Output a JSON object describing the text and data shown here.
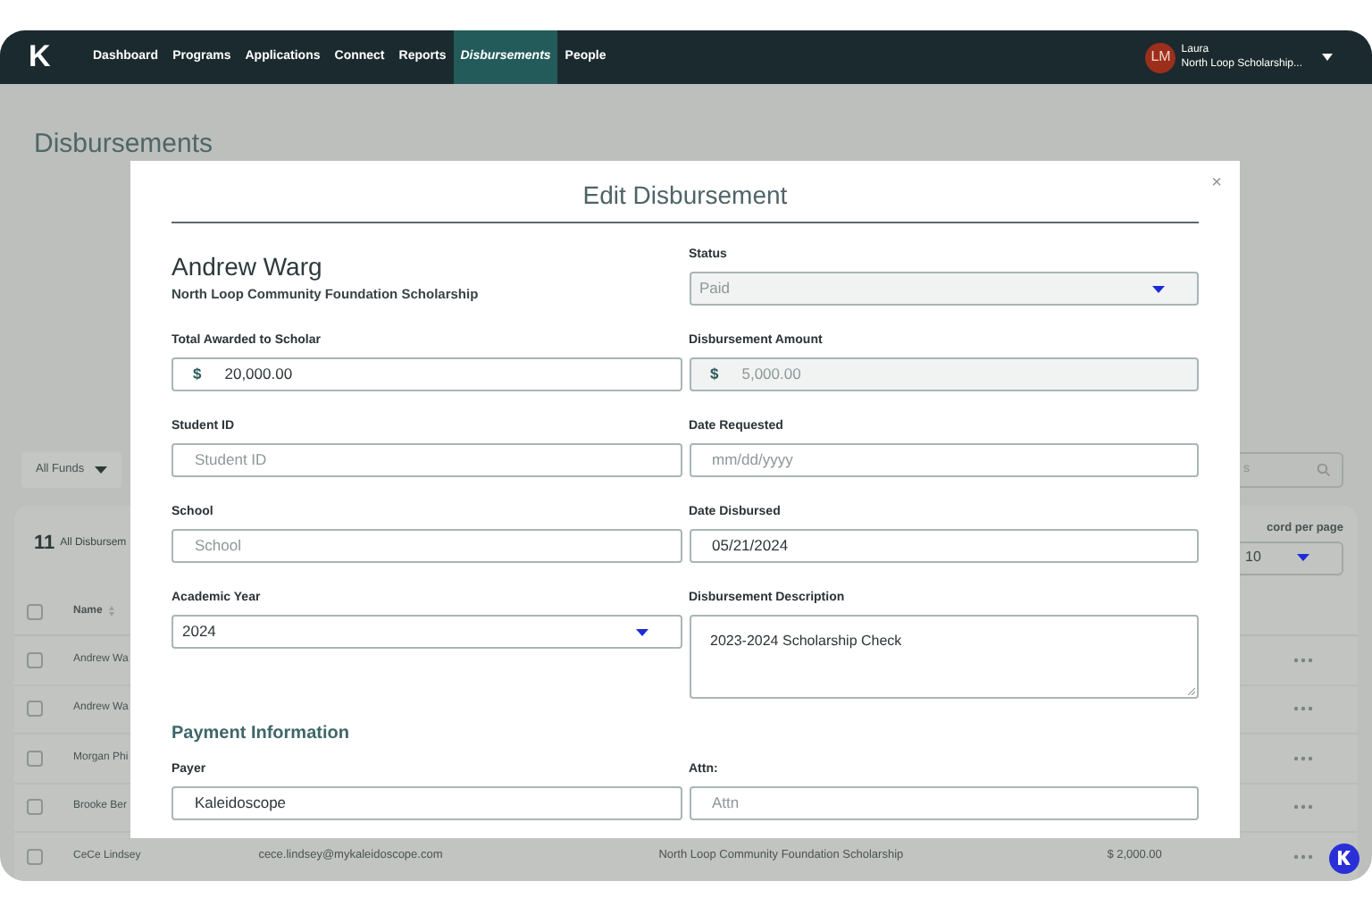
{
  "nav": {
    "logo": "K",
    "items": [
      {
        "label": "Dashboard",
        "selected": false
      },
      {
        "label": "Programs",
        "selected": false
      },
      {
        "label": "Applications",
        "selected": false
      },
      {
        "label": "Connect",
        "selected": false
      },
      {
        "label": "Reports",
        "selected": false
      },
      {
        "label": "Disbursements",
        "selected": true
      },
      {
        "label": "People",
        "selected": false
      }
    ],
    "user": {
      "initials": "LM",
      "name": "Laura",
      "org": "North Loop Scholarship..."
    }
  },
  "page": {
    "title": "Disbursements",
    "fund_filter": "All Funds",
    "count": "11",
    "count_label": "All Disbursem",
    "search_placeholder": "s",
    "per_page_label": "cord per page",
    "per_page": "10",
    "table": {
      "header": {
        "label": "Name",
        "checked": false
      },
      "rows": [
        {
          "checked": false,
          "cells": [
            "Andrew Wa"
          ]
        },
        {
          "checked": false,
          "cells": [
            "Andrew Wa"
          ]
        },
        {
          "checked": false,
          "cells": [
            "Morgan Phi"
          ]
        },
        {
          "checked": false,
          "cells": [
            "Brooke Ber"
          ]
        },
        {
          "checked": false,
          "cells": [
            "CeCe Lindsey",
            "cece.lindsey@mykaleidoscope.com",
            "North Loop Community Foundation Scholarship",
            "$ 2,000.00"
          ]
        }
      ]
    }
  },
  "modal": {
    "title": "Edit Disbursement",
    "close": "×",
    "scholar_name": "Andrew Warg",
    "scholar_program": "North Loop Community Foundation Scholarship",
    "fields": [
      {
        "kind": "select",
        "label": "Status",
        "value": "Paid",
        "disabled": true
      },
      {
        "kind": "money",
        "label": "Total Awarded to Scholar",
        "prefix": "$",
        "value": "20,000.00",
        "disabled": false
      },
      {
        "kind": "money",
        "label": "Disbursement Amount",
        "prefix": "$",
        "value": "5,000.00",
        "disabled": true
      },
      {
        "kind": "text",
        "label": "Student ID",
        "placeholder": "Student ID",
        "disabled": false
      },
      {
        "kind": "text",
        "label": "Date Requested",
        "placeholder": "mm/dd/yyyy",
        "disabled": false
      },
      {
        "kind": "text",
        "label": "School",
        "placeholder": "School",
        "disabled": false
      },
      {
        "kind": "text",
        "label": "Date Disbursed",
        "value": "05/21/2024",
        "disabled": false
      },
      {
        "kind": "select",
        "label": "Academic Year",
        "value": "2024",
        "disabled": false
      },
      {
        "kind": "textarea",
        "label": "Disbursement Description",
        "value": "2023-2024 Scholarship Check",
        "disabled": false
      }
    ],
    "section": "Payment Information",
    "payment_fields": [
      {
        "kind": "text",
        "label": "Payer",
        "value": "Kaleidoscope",
        "disabled": false
      },
      {
        "kind": "text",
        "label": "Attn:",
        "placeholder": "Attn",
        "disabled": false
      }
    ]
  }
}
